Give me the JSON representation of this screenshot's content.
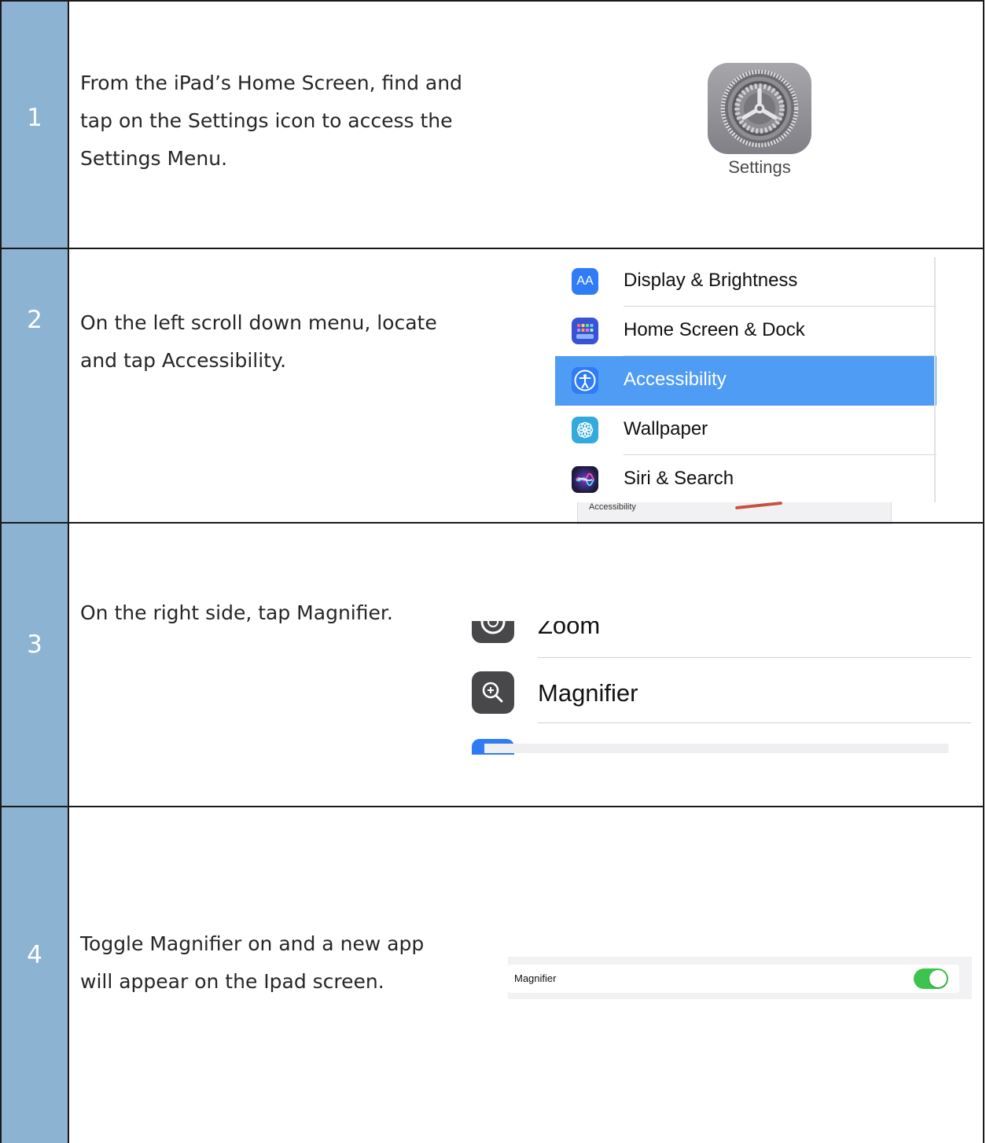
{
  "steps": [
    {
      "number": "1",
      "lines": [
        "From the iPad’s Home Screen, find and",
        "tap on the Settings icon to access the",
        "Settings Menu."
      ],
      "app_icon": {
        "name": "gear-icon",
        "label": "Settings"
      }
    },
    {
      "number": "2",
      "lines": [
        "On the left scroll down menu, locate",
        "and tap Accessibility."
      ],
      "menu": [
        {
          "label": "Display & Brightness",
          "icon": "text-size-icon",
          "icon_text": "AA",
          "color": "#2f7cf6",
          "selected": false
        },
        {
          "label": "Home Screen & Dock",
          "icon": "app-grid-icon",
          "color": "#3853d6",
          "selected": false
        },
        {
          "label": "Accessibility",
          "icon": "accessibility-icon",
          "color": "#2f7cf6",
          "selected": true
        },
        {
          "label": "Wallpaper",
          "icon": "flower-icon",
          "color": "#34aadc",
          "selected": false
        },
        {
          "label": "Siri & Search",
          "icon": "siri-icon",
          "color": "#1b1b3a",
          "selected": false
        }
      ],
      "under_text": "Accessibility"
    },
    {
      "number": "3",
      "lines": [
        "On the right side, tap Magnifier."
      ],
      "list": [
        {
          "label": "Zoom",
          "icon": "zoom-icon"
        },
        {
          "label": "Magnifier",
          "icon": "magnifier-plus-icon"
        }
      ]
    },
    {
      "number": "4",
      "lines": [
        "Toggle Magnifier on and a new app",
        "will appear on the Ipad screen."
      ],
      "toggle": {
        "label": "Magnifier",
        "on": true,
        "color": "#3cc44f"
      }
    }
  ],
  "colors": {
    "number_column": "#8db3d3",
    "selected_row": "#4f9cf5",
    "text": "#262626"
  }
}
